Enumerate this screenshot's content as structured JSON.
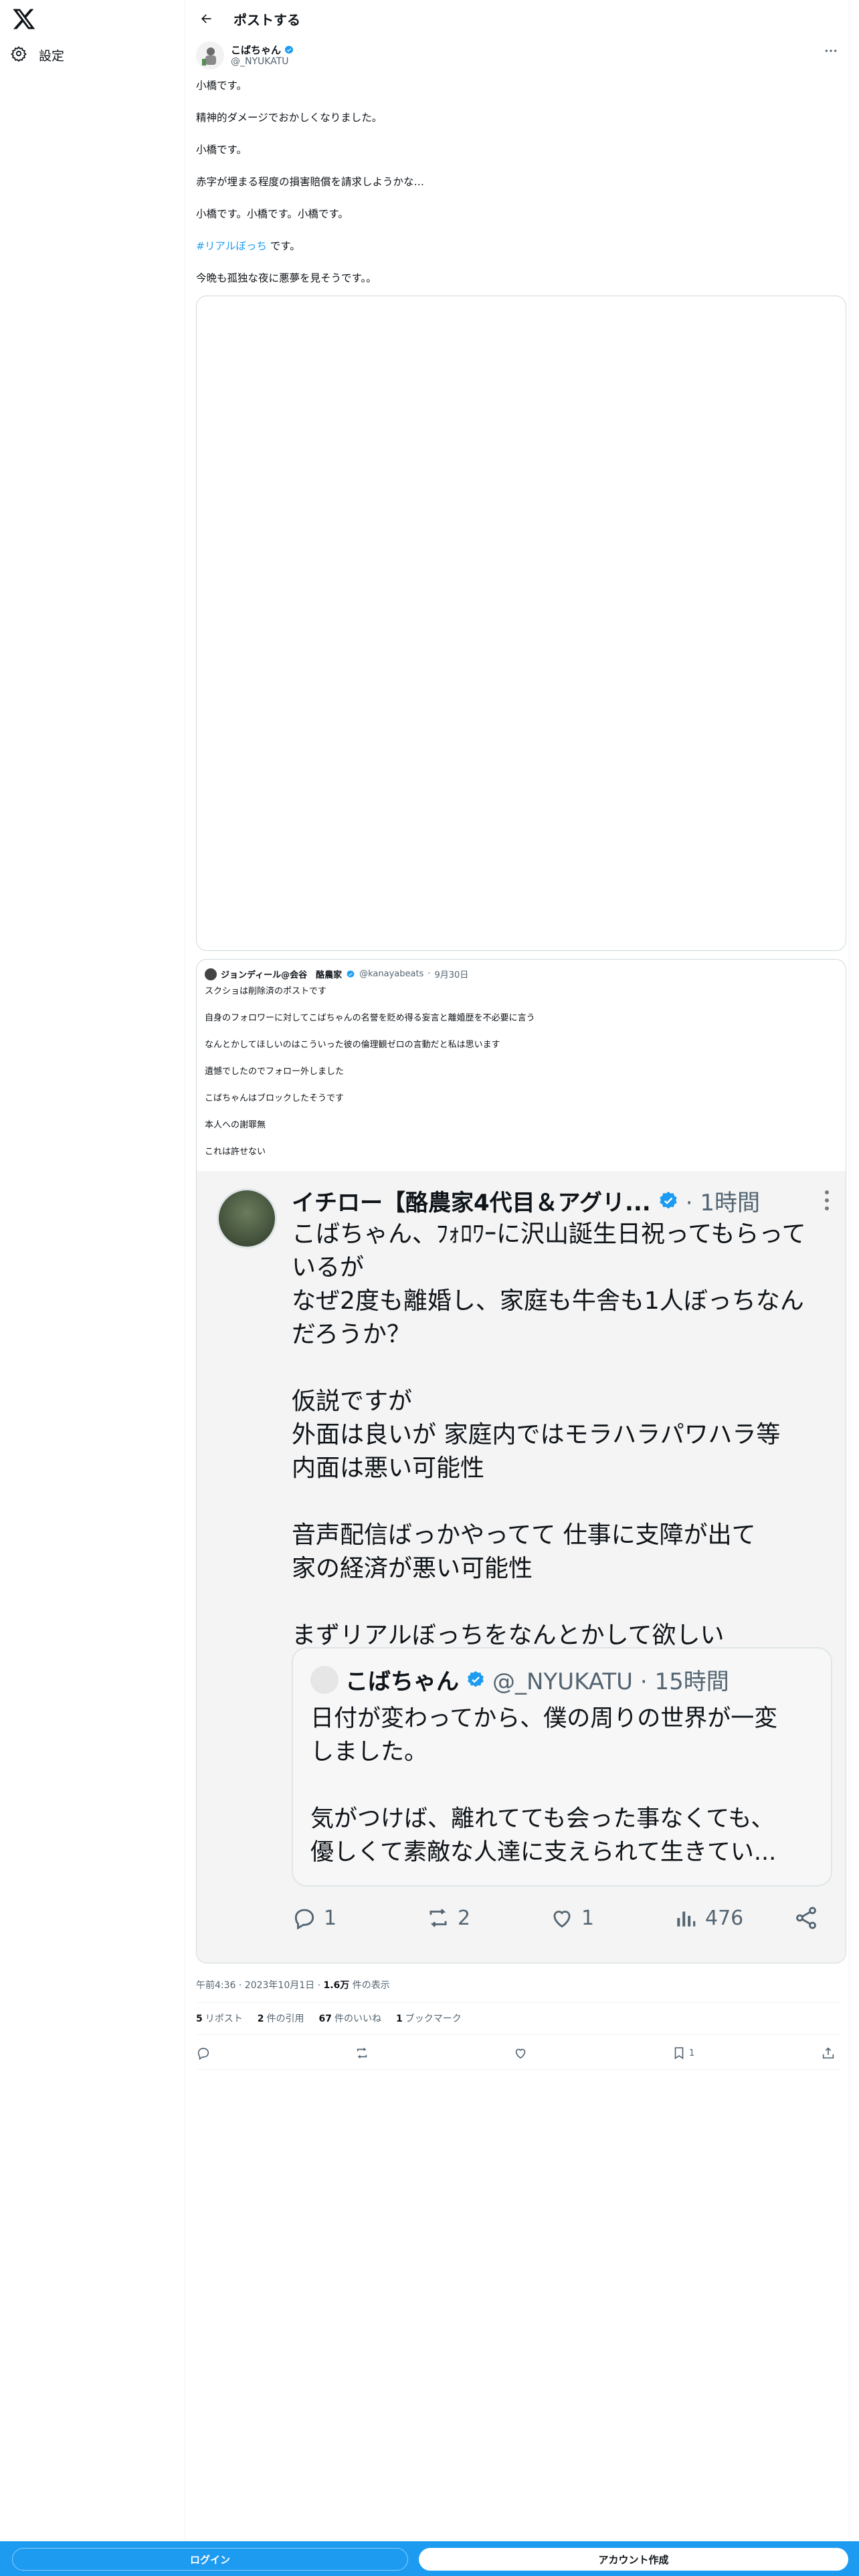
{
  "sidebar": {
    "logo": "x-logo-icon",
    "settings_label": "設定"
  },
  "header": {
    "title": "ポストする"
  },
  "post": {
    "author_name": "こばちゃん",
    "author_handle": "@_NYUKATU",
    "lines": [
      "小橋です。",
      "精神的ダメージでおかしくなりました。",
      "小橋です。",
      "赤字が埋まる程度の損害賠償を請求しようかな…",
      "小橋です。小橋です。小橋です。"
    ],
    "hashtag": "#リアルぼっち",
    "hashtag_suffix": " です。",
    "last_line": "今晩も孤独な夜に悪夢を見そうです。。",
    "timestamp": "午前4:36 · 2023年10月1日 · ",
    "views_count": "1.6万",
    "views_label": " 件の表示"
  },
  "quote": {
    "author_name": "ジョンディール@会谷　酪農家",
    "author_handle": "@kanayabeats",
    "separator": "·",
    "date": "9月30日",
    "lines": [
      "スクショは削除済のポストです",
      "自身のフォロワーに対してこばちゃんの名誉を貶め得る妄言と離婚歴を不必要に言う",
      "なんとかしてほしいのはこういった彼の倫理観ゼロの言動だと私は思います",
      "遺憾でしたのでフォロー外しました",
      "こばちゃんはブロックしたそうです",
      "本人への謝罪無",
      "これは許せない"
    ]
  },
  "embed": {
    "author_name": "イチロー【酪農家4代目＆アグリ...",
    "time": "· 1時間",
    "lines": [
      "こばちゃん、ﾌｫﾛﾜｰに沢山誕生日祝ってもらって",
      "いるが",
      "なぜ2度も離婚し、家庭も牛舎も1人ぼっちなん",
      "だろうか？",
      "",
      "仮説ですが",
      "外面は良いが 家庭内ではモラハラパワハラ等",
      "内面は悪い可能性",
      "",
      "音声配信ばっかやってて 仕事に支障が出て",
      "家の経済が悪い可能性",
      "",
      "まずリアルぼっちをなんとかして欲しい"
    ],
    "inner": {
      "author_name": "こばちゃん",
      "author_handle": "@_NYUKATU · 15時間",
      "lines": [
        "日付が変わってから、僕の周りの世界が一変",
        "しました。",
        "",
        "気がつけば、離れてても会った事なくても、",
        "優しくて素敵な人達に支えられて生きてい..."
      ]
    },
    "replies": "1",
    "reposts": "2",
    "likes": "1",
    "views": "476"
  },
  "stats": {
    "reposts_count": "5",
    "reposts_label": "リポスト",
    "quotes_count": "2",
    "quotes_label": "件の引用",
    "likes_count": "67",
    "likes_label": "件のいいね",
    "bookmarks_count": "1",
    "bookmarks_label": "ブックマーク"
  },
  "actions": {
    "bookmark_count": "1"
  },
  "bottom": {
    "login_label": "ログイン",
    "signup_label": "アカウント作成"
  },
  "colors": {
    "accent": "#1d9bf0",
    "text": "#0f1419",
    "muted": "#536471",
    "border": "#cfd9de"
  }
}
